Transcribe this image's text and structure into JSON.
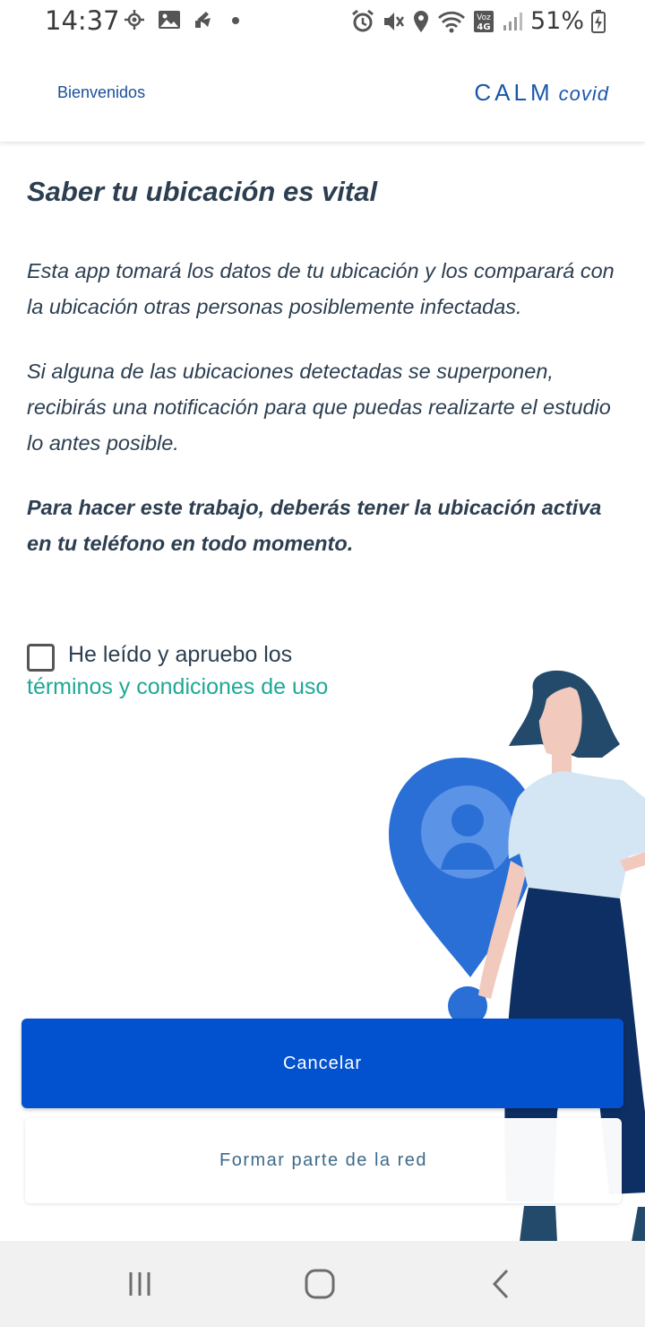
{
  "status_bar": {
    "time": "14:37",
    "battery_percent": "51%",
    "left_icons": [
      "location-icon",
      "gallery-icon",
      "app-icon",
      "dot-icon"
    ],
    "right_icons": [
      "alarm-icon",
      "mute-icon",
      "location-pin-icon",
      "wifi-icon",
      "volte-icon",
      "signal-icon",
      "battery-icon"
    ],
    "volte_label_top": "Voz",
    "volte_label_bottom": "4G"
  },
  "header": {
    "back_label": "Bienvenidos",
    "brand_main": "CALM",
    "brand_sub": "covid"
  },
  "content": {
    "title": "Saber tu ubicación es vital",
    "paragraph1": "Esta app tomará los datos de tu ubicación y los comparará con la ubicación otras personas posiblemente infectadas.",
    "paragraph2": "Si alguna de las ubicaciones detectadas se superponen, recibirás una notificación para que puedas realizarte el estudio lo antes posible.",
    "paragraph3": "Para hacer este trabajo, deberás tener la ubicación activa en tu teléfono en todo momento."
  },
  "terms": {
    "checked": false,
    "text": "He leído y apruebo los",
    "link": "términos y condiciones de uso"
  },
  "buttons": {
    "cancel_label": "Cancelar",
    "join_label": "Formar parte de la red"
  },
  "colors": {
    "primary": "#0251cf",
    "link": "#1fa896",
    "brand": "#1a56a8",
    "text": "#2c3e50"
  }
}
